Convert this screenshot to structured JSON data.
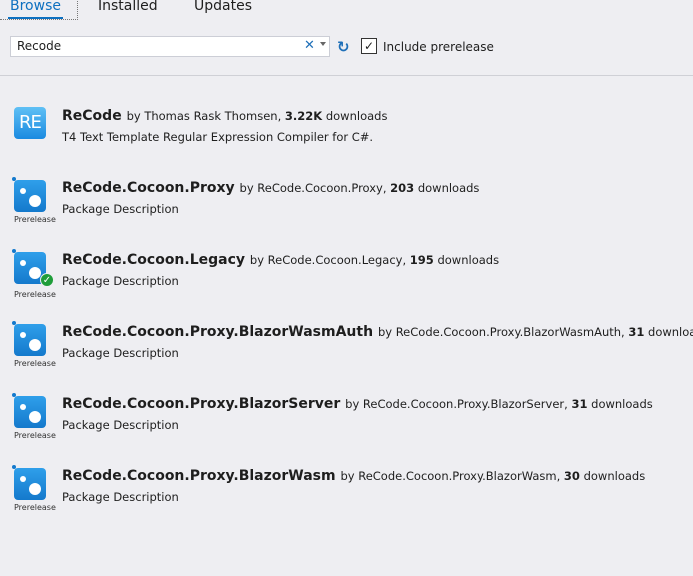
{
  "tabs": [
    {
      "label": "Browse"
    },
    {
      "label": "Installed"
    },
    {
      "label": "Updates"
    }
  ],
  "search": {
    "value": "Recode"
  },
  "include_prerelease": {
    "label": "Include prerelease",
    "checked": true
  },
  "packages": [
    {
      "name": "ReCode",
      "by": "by Thomas Rask Thomsen,",
      "downloads": "3.22K",
      "downloads_suffix": "downloads",
      "description": "T4 Text Template Regular Expression Compiler for C#.",
      "icon": "RE"
    },
    {
      "name": "ReCode.Cocoon.Proxy",
      "by": "by ReCode.Cocoon.Proxy,",
      "downloads": "203",
      "downloads_suffix": "downloads",
      "description": "Package Description",
      "badge": "Prerelease"
    },
    {
      "name": "ReCode.Cocoon.Legacy",
      "by": "by ReCode.Cocoon.Legacy,",
      "downloads": "195",
      "downloads_suffix": "downloads",
      "description": "Package Description",
      "badge": "Prerelease",
      "installed": true
    },
    {
      "name": "ReCode.Cocoon.Proxy.BlazorWasmAuth",
      "by": "by ReCode.Cocoon.Proxy.BlazorWasmAuth,",
      "downloads": "31",
      "downloads_suffix": "downloads",
      "description": "Package Description",
      "badge": "Prerelease"
    },
    {
      "name": "ReCode.Cocoon.Proxy.BlazorServer",
      "by": "by ReCode.Cocoon.Proxy.BlazorServer,",
      "downloads": "31",
      "downloads_suffix": "downloads",
      "description": "Package Description",
      "badge": "Prerelease"
    },
    {
      "name": "ReCode.Cocoon.Proxy.BlazorWasm",
      "by": "by ReCode.Cocoon.Proxy.BlazorWasm,",
      "downloads": "30",
      "downloads_suffix": "downloads",
      "description": "Package Description",
      "badge": "Prerelease"
    }
  ]
}
